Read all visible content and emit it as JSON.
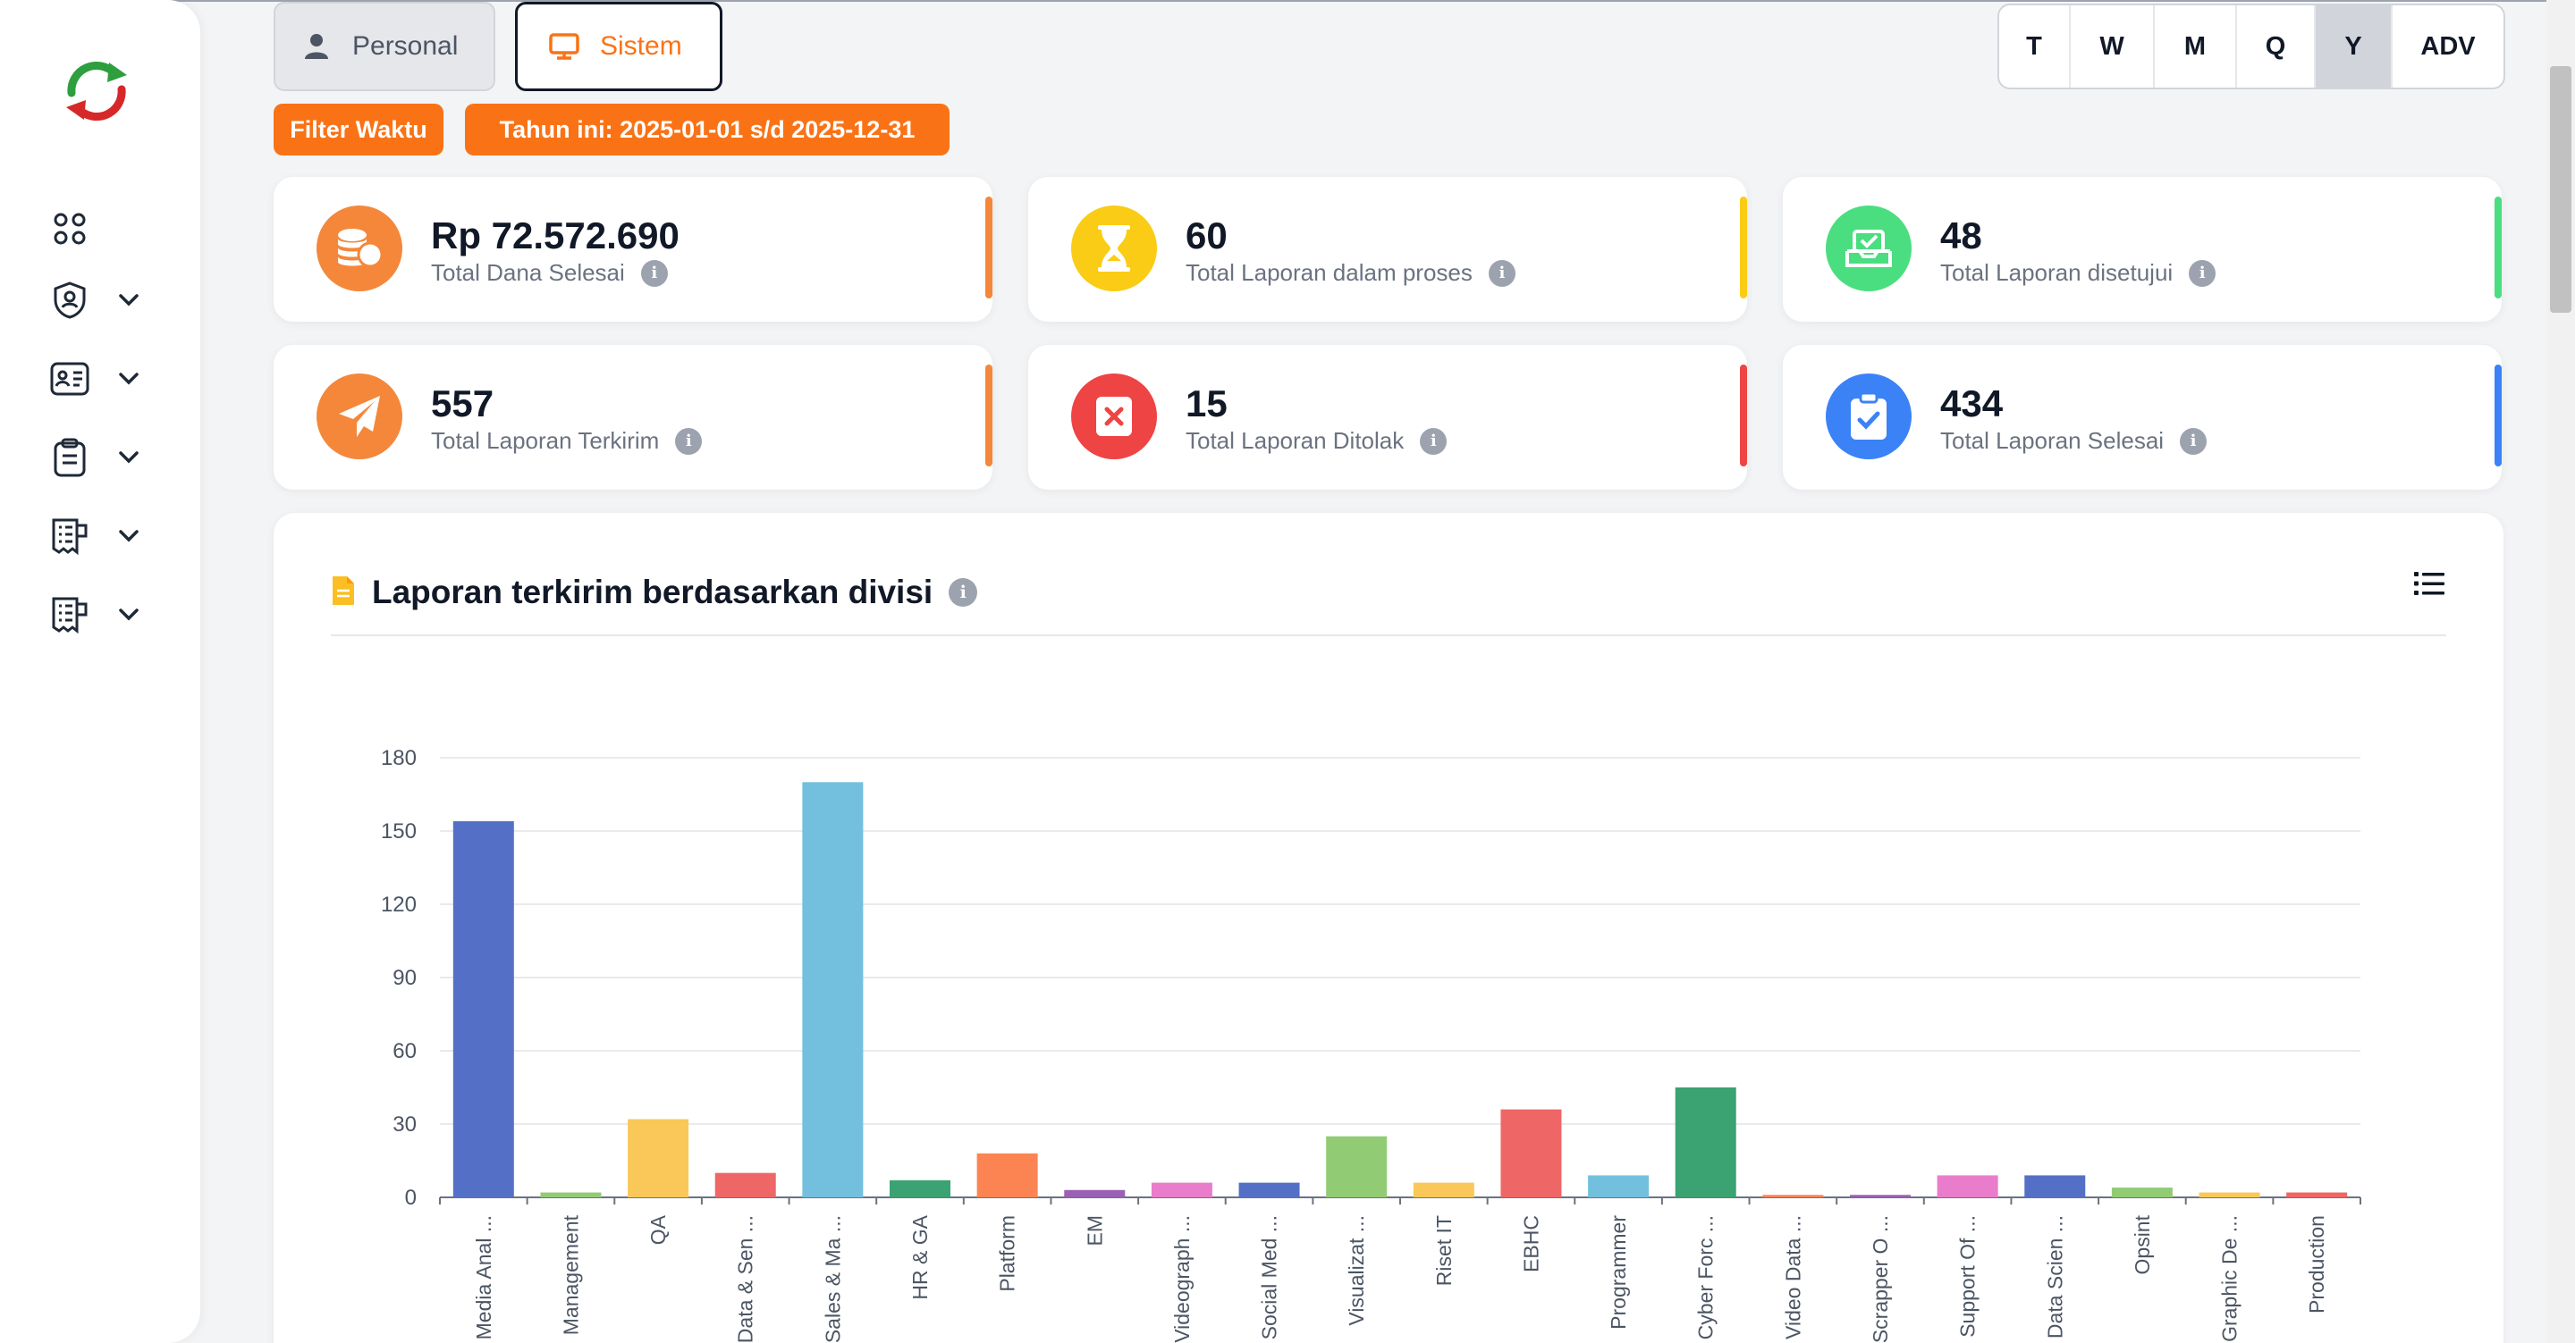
{
  "tabs": {
    "personal_label": "Personal",
    "sistem_label": "Sistem"
  },
  "period_buttons": [
    {
      "label": "T",
      "active": false
    },
    {
      "label": "W",
      "active": false
    },
    {
      "label": "M",
      "active": false
    },
    {
      "label": "Q",
      "active": false
    },
    {
      "label": "Y",
      "active": true
    },
    {
      "label": "ADV",
      "active": false
    }
  ],
  "filter": {
    "label": "Filter Waktu",
    "range": "Tahun ini: 2025-01-01 s/d 2025-12-31"
  },
  "stats": [
    {
      "value": "Rp 72.572.690",
      "label": "Total Dana Selesai",
      "icon": "coins-icon",
      "color": "#f5873a",
      "accent": "#f5873a"
    },
    {
      "value": "60",
      "label": "Total Laporan dalam proses",
      "icon": "hourglass-icon",
      "color": "#facc15",
      "accent": "#facc15"
    },
    {
      "value": "48",
      "label": "Total Laporan disetujui",
      "icon": "approved-tray-icon",
      "color": "#4ade80",
      "accent": "#4ade80"
    },
    {
      "value": "557",
      "label": "Total Laporan Terkirim",
      "icon": "paper-plane-icon",
      "color": "#f5873a",
      "accent": "#f5873a"
    },
    {
      "value": "15",
      "label": "Total Laporan Ditolak",
      "icon": "rejected-icon",
      "color": "#ef4444",
      "accent": "#ef4444"
    },
    {
      "value": "434",
      "label": "Total Laporan Selesai",
      "icon": "clipboard-check-icon",
      "color": "#3b82f6",
      "accent": "#3b82f6"
    }
  ],
  "chart_section": {
    "title": "Laporan terkirim berdasarkan divisi"
  },
  "chart_data": {
    "type": "bar",
    "categories": [
      "Media Anal ...",
      "Management",
      "QA",
      "Data & Sen ...",
      "Sales & Ma ...",
      "HR & GA",
      "Platform",
      "EM",
      "Videograph ...",
      "Social Med ...",
      "Visualizat ...",
      "Riset IT",
      "EBHC",
      "Programmer",
      "Cyber Forc ...",
      "Video Data ...",
      "Scrapper O ...",
      "Support Of ...",
      "Data Scien ...",
      "Opsint",
      "Graphic De ...",
      "Production"
    ],
    "values": [
      154,
      2,
      32,
      10,
      170,
      7,
      18,
      3,
      6,
      6,
      25,
      6,
      36,
      9,
      45,
      1,
      1,
      9,
      9,
      4,
      2,
      2
    ],
    "colors": [
      "#5470c6",
      "#91cc75",
      "#fac858",
      "#ee6666",
      "#73c0de",
      "#3ba272",
      "#fc8452",
      "#9a60b4",
      "#ea7ccc",
      "#5470c6",
      "#91cc75",
      "#fac858",
      "#ee6666",
      "#73c0de",
      "#3ba272",
      "#fc8452",
      "#9a60b4",
      "#ea7ccc",
      "#5470c6",
      "#91cc75",
      "#fac858",
      "#ee6666"
    ],
    "y_ticks": [
      0,
      30,
      60,
      90,
      120,
      150,
      180
    ],
    "ylim": [
      0,
      180
    ],
    "grid": true
  }
}
